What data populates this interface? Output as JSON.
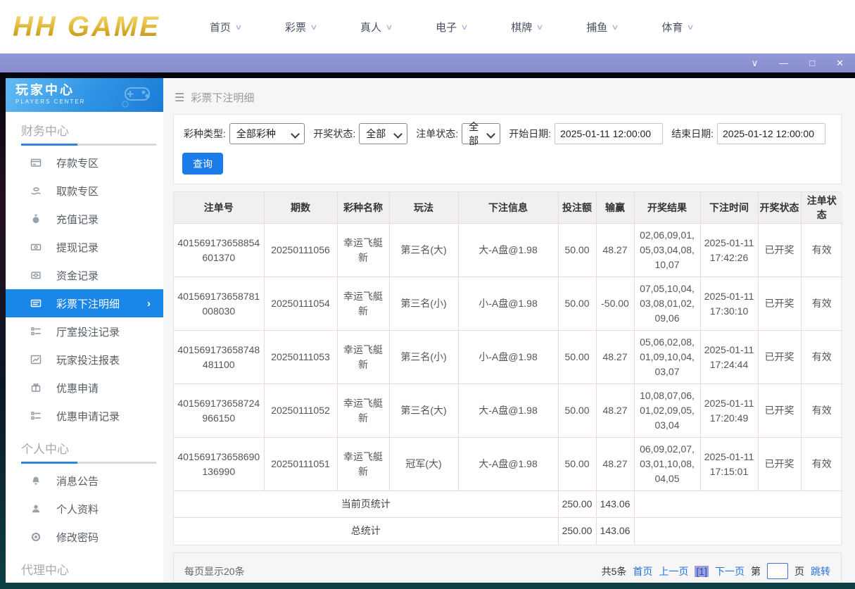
{
  "site_header": {
    "logo_text": "HH GAME",
    "nav": [
      {
        "label": "首页"
      },
      {
        "label": "彩票"
      },
      {
        "label": "真人"
      },
      {
        "label": "电子"
      },
      {
        "label": "棋牌"
      },
      {
        "label": "捕鱼"
      },
      {
        "label": "体育"
      }
    ]
  },
  "icons": {
    "chevron_down": "∨",
    "chevron_right": "›",
    "minimize": "—",
    "maximize": "□",
    "close": "✕",
    "hamburger": "☰"
  },
  "sidebar": {
    "title": "玩家中心",
    "subtitle": "PLAYERS CENTER",
    "sections": [
      {
        "title": "财务中心",
        "items": [
          {
            "label": "存款专区",
            "icon": "bank-card"
          },
          {
            "label": "取款专区",
            "icon": "withdraw-hand"
          },
          {
            "label": "充值记录",
            "icon": "money-bag"
          },
          {
            "label": "提现记录",
            "icon": "banknote"
          },
          {
            "label": "资金记录",
            "icon": "coin-record"
          },
          {
            "label": "彩票下注明细",
            "icon": "list-card",
            "active": true
          },
          {
            "label": "厅室投注记录",
            "icon": "list"
          },
          {
            "label": "玩家投注报表",
            "icon": "chart"
          },
          {
            "label": "优惠申请",
            "icon": "gift"
          },
          {
            "label": "优惠申请记录",
            "icon": "list"
          }
        ]
      },
      {
        "title": "个人中心",
        "items": [
          {
            "label": "消息公告",
            "icon": "bell"
          },
          {
            "label": "个人资料",
            "icon": "user"
          },
          {
            "label": "修改密码",
            "icon": "gear"
          }
        ]
      },
      {
        "title": "代理中心",
        "items": []
      }
    ]
  },
  "breadcrumb": {
    "title": "彩票下注明细"
  },
  "filters": {
    "lottery_type": {
      "label": "彩种类型:",
      "value": "全部彩种"
    },
    "draw_status": {
      "label": "开奖状态:",
      "value": "全部"
    },
    "order_status": {
      "label": "注单状态:",
      "value": "全部"
    },
    "start_date": {
      "label": "开始日期:",
      "value": "2025-01-11 12:00:00"
    },
    "end_date": {
      "label": "结束日期:",
      "value": "2025-01-12 12:00:00"
    },
    "search_button": "查询"
  },
  "table": {
    "headers": [
      "注单号",
      "期数",
      "彩种名称",
      "玩法",
      "下注信息",
      "投注额",
      "输赢",
      "开奖结果",
      "下注时间",
      "开奖状态",
      "注单状态"
    ],
    "rows": [
      [
        "401569173658854601370",
        "20250111056",
        "幸运飞艇新",
        "第三名(大)",
        "大-A盘@1.98",
        "50.00",
        "48.27",
        "02,06,09,01,05,03,04,08,10,07",
        "2025-01-11 17:42:26",
        "已开奖",
        "有效"
      ],
      [
        "401569173658781008030",
        "20250111054",
        "幸运飞艇新",
        "第三名(小)",
        "小-A盘@1.98",
        "50.00",
        "-50.00",
        "07,05,10,04,03,08,01,02,09,06",
        "2025-01-11 17:30:10",
        "已开奖",
        "有效"
      ],
      [
        "401569173658748481100",
        "20250111053",
        "幸运飞艇新",
        "第三名(小)",
        "小-A盘@1.98",
        "50.00",
        "48.27",
        "05,06,02,08,01,09,10,04,03,07",
        "2025-01-11 17:24:44",
        "已开奖",
        "有效"
      ],
      [
        "401569173658724966150",
        "20250111052",
        "幸运飞艇新",
        "第三名(大)",
        "大-A盘@1.98",
        "50.00",
        "48.27",
        "10,08,07,06,01,02,09,05,03,04",
        "2025-01-11 17:20:49",
        "已开奖",
        "有效"
      ],
      [
        "401569173658690136990",
        "20250111051",
        "幸运飞艇新",
        "冠军(大)",
        "大-A盘@1.98",
        "50.00",
        "48.27",
        "06,09,02,07,03,01,10,08,04,05",
        "2025-01-11 17:15:01",
        "已开奖",
        "有效"
      ]
    ],
    "summary": [
      {
        "label": "当前页统计",
        "bet_total": "250.00",
        "winloss_total": "143.06"
      },
      {
        "label": "总统计",
        "bet_total": "250.00",
        "winloss_total": "143.06"
      }
    ]
  },
  "pagination": {
    "per_page_text": "每页显示20条",
    "total_text": "共5条",
    "first_label": "首页",
    "prev_label": "上一页",
    "current_page": "[1]",
    "next_label": "下一页",
    "page_prefix": "第",
    "page_suffix": "页",
    "jump_label": "跳转",
    "page_input_value": ""
  },
  "colors": {
    "accent_blue": "#1a86e8",
    "link_blue": "#2472e0",
    "titlebar_purple": "#8c91d2",
    "table_border_pink": "#f3d7d7",
    "logo_gold": "#d9ae3a"
  }
}
